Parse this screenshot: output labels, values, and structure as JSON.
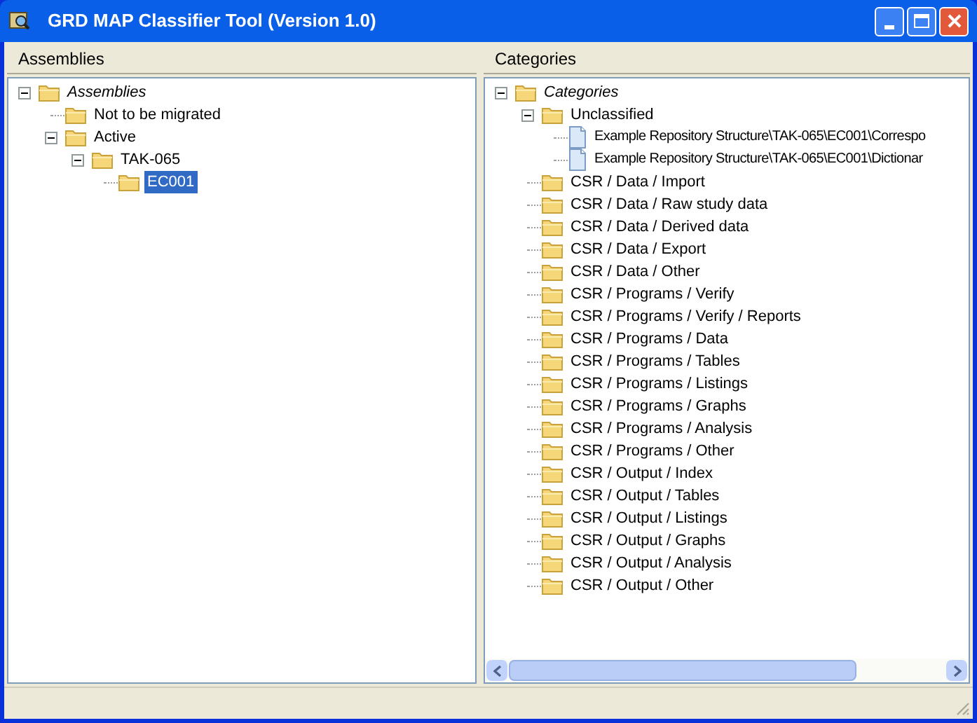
{
  "window": {
    "title": "GRD MAP Classifier Tool (Version 1.0)"
  },
  "left_panel": {
    "header": "Assemblies",
    "tree": [
      {
        "label": "Assemblies",
        "kind": "root",
        "expanded": true,
        "selected": false,
        "children": [
          {
            "label": "Not to be migrated",
            "kind": "folder",
            "selected": false
          },
          {
            "label": "Active",
            "kind": "folder",
            "expanded": true,
            "selected": false,
            "children": [
              {
                "label": "TAK-065",
                "kind": "folder",
                "expanded": true,
                "selected": false,
                "children": [
                  {
                    "label": "EC001",
                    "kind": "folder",
                    "selected": true
                  }
                ]
              }
            ]
          }
        ]
      }
    ]
  },
  "right_panel": {
    "header": "Categories",
    "tree": [
      {
        "label": "Categories",
        "kind": "root",
        "expanded": true,
        "selected": false,
        "children": [
          {
            "label": "Unclassified",
            "kind": "folder",
            "expanded": true,
            "selected": false,
            "children": [
              {
                "label": "Example Repository Structure\\TAK-065\\EC001\\Correspo",
                "kind": "file",
                "selected": false
              },
              {
                "label": "Example Repository Structure\\TAK-065\\EC001\\Dictionar",
                "kind": "file",
                "selected": false
              }
            ]
          },
          {
            "label": "CSR / Data / Import",
            "kind": "folder",
            "selected": false
          },
          {
            "label": "CSR / Data / Raw study data",
            "kind": "folder",
            "selected": false
          },
          {
            "label": "CSR / Data / Derived data",
            "kind": "folder",
            "selected": false
          },
          {
            "label": "CSR / Data / Export",
            "kind": "folder",
            "selected": false
          },
          {
            "label": "CSR / Data / Other",
            "kind": "folder",
            "selected": false
          },
          {
            "label": "CSR / Programs / Verify",
            "kind": "folder",
            "selected": false
          },
          {
            "label": "CSR / Programs / Verify / Reports",
            "kind": "folder",
            "selected": false
          },
          {
            "label": "CSR / Programs / Data",
            "kind": "folder",
            "selected": false
          },
          {
            "label": "CSR / Programs / Tables",
            "kind": "folder",
            "selected": false
          },
          {
            "label": "CSR / Programs / Listings",
            "kind": "folder",
            "selected": false
          },
          {
            "label": "CSR / Programs / Graphs",
            "kind": "folder",
            "selected": false
          },
          {
            "label": "CSR / Programs / Analysis",
            "kind": "folder",
            "selected": false
          },
          {
            "label": "CSR / Programs / Other",
            "kind": "folder",
            "selected": false
          },
          {
            "label": "CSR / Output / Index",
            "kind": "folder",
            "selected": false
          },
          {
            "label": "CSR / Output / Tables",
            "kind": "folder",
            "selected": false
          },
          {
            "label": "CSR / Output / Listings",
            "kind": "folder",
            "selected": false
          },
          {
            "label": "CSR / Output / Graphs",
            "kind": "folder",
            "selected": false
          },
          {
            "label": "CSR / Output / Analysis",
            "kind": "folder",
            "selected": false
          },
          {
            "label": "CSR / Output / Other",
            "kind": "folder",
            "selected": false
          }
        ]
      }
    ]
  }
}
